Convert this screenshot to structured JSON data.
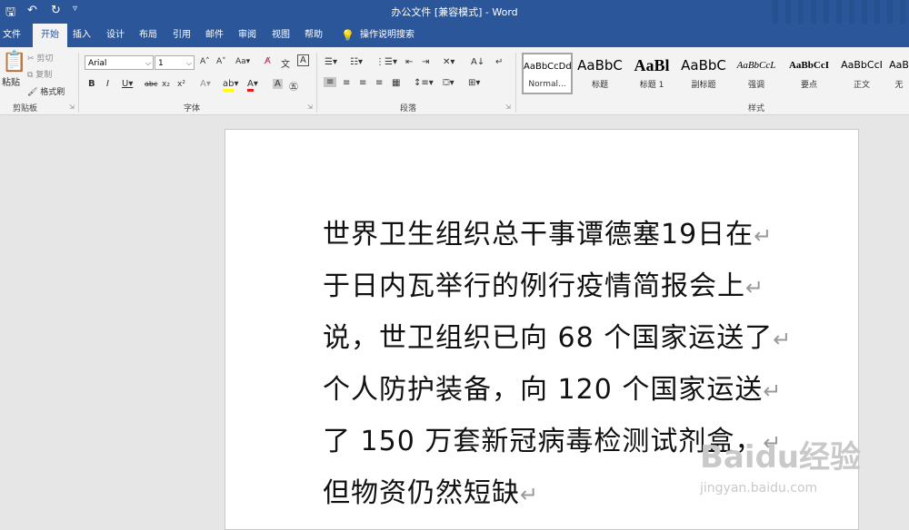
{
  "window": {
    "title": "办公文件 [兼容模式] - Word"
  },
  "tabs": [
    "文件",
    "开始",
    "插入",
    "设计",
    "布局",
    "引用",
    "邮件",
    "审阅",
    "视图",
    "帮助"
  ],
  "tell_me": "操作说明搜索",
  "clipboard": {
    "paste": "粘贴",
    "cut": "剪切",
    "copy": "复制",
    "format_painter": "格式刷",
    "group": "剪贴板"
  },
  "font": {
    "name": "Arial",
    "size": "1",
    "group": "字体"
  },
  "paragraph": {
    "group": "段落"
  },
  "styles": {
    "group": "样式",
    "items": [
      {
        "sample": "AaBbCcDd",
        "name": "Normal..."
      },
      {
        "sample": "AaBbC",
        "name": "标题"
      },
      {
        "sample": "AaBl",
        "name": "标题 1"
      },
      {
        "sample": "AaBbC",
        "name": "副标题"
      },
      {
        "sample": "AaBbCcL",
        "name": "强调"
      },
      {
        "sample": "AaBbCcI",
        "name": "要点"
      },
      {
        "sample": "AaBbCcI",
        "name": "正文"
      },
      {
        "sample": "AaB",
        "name": "无"
      }
    ]
  },
  "document": {
    "lines": [
      "世界卫生组织总干事谭德塞19日在",
      "于日内瓦举行的例行疫情简报会上",
      "说，世卫组织已向 68 个国家运送了",
      "个人防护装备，向 120 个国家运送",
      "了 150 万套新冠病毒检测试剂盒，",
      "但物资仍然短缺"
    ],
    "paragraph_mark": "↵"
  },
  "watermark": {
    "brand": "Baidu经验",
    "url": "jingyan.baidu.com"
  },
  "colors": {
    "accent": "#2b579a",
    "font_color": "#e02020",
    "highlight": "#ffff00"
  }
}
